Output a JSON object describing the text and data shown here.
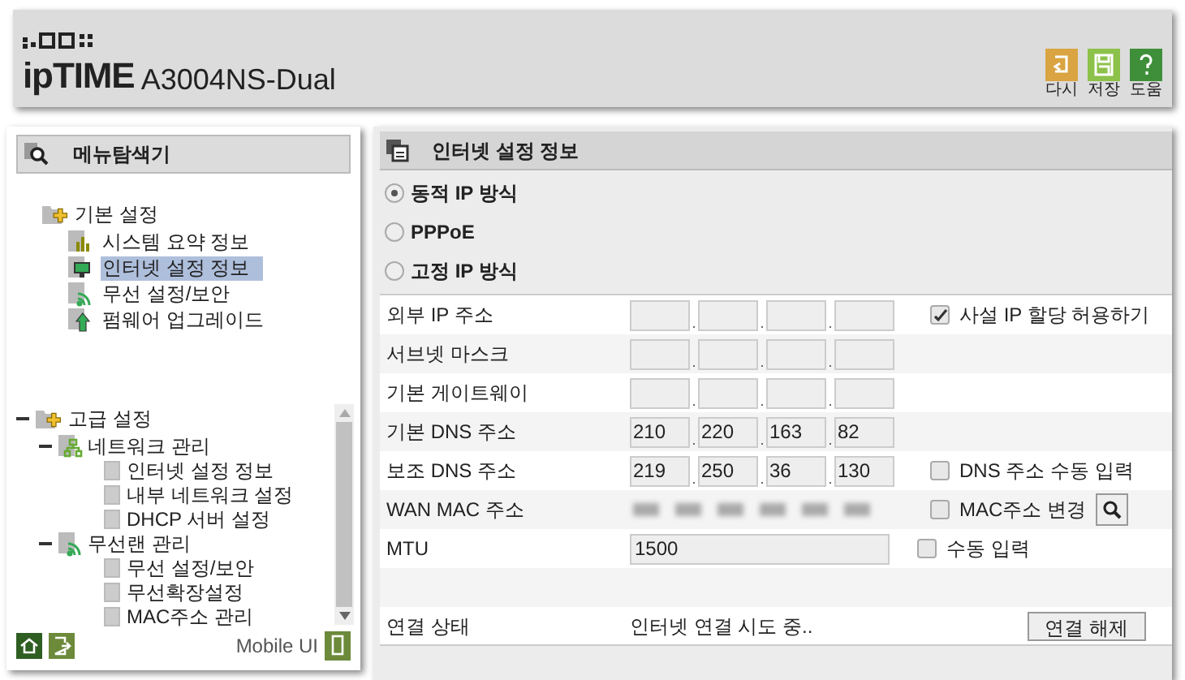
{
  "header": {
    "brand": "ipTIME",
    "model": "A3004NS-Dual",
    "actions": [
      {
        "label": "다시",
        "kind": "undo",
        "color": "#d9a441"
      },
      {
        "label": "저장",
        "kind": "save",
        "color": "#8cc14a"
      },
      {
        "label": "도움",
        "kind": "help",
        "color": "#3f8f3a"
      }
    ]
  },
  "sidebar": {
    "title": "메뉴탐색기",
    "basic": {
      "label": "기본 설정",
      "children": [
        {
          "label": "시스템 요약 정보",
          "kind": "chart",
          "selected": false
        },
        {
          "label": "인터넷 설정 정보",
          "kind": "monitor",
          "selected": true
        },
        {
          "label": "무선 설정/보안",
          "kind": "wifi",
          "selected": false
        },
        {
          "label": "펌웨어 업그레이드",
          "kind": "upgrade",
          "selected": false
        }
      ]
    },
    "advanced": {
      "label": "고급 설정",
      "expanded": true,
      "children": [
        {
          "label": "네트워크 관리",
          "kind": "network",
          "expanded": true,
          "children": [
            {
              "label": "인터넷 설정 정보"
            },
            {
              "label": "내부 네트워크 설정"
            },
            {
              "label": "DHCP 서버 설정"
            }
          ]
        },
        {
          "label": "무선랜 관리",
          "kind": "wifi",
          "expanded": true,
          "children": [
            {
              "label": "무선 설정/보안"
            },
            {
              "label": "무선확장설정"
            },
            {
              "label": "MAC주소 관리"
            }
          ]
        }
      ]
    },
    "footer": {
      "mobile_label": "Mobile UI"
    }
  },
  "panel": {
    "title": "인터넷 설정 정보",
    "modes": [
      {
        "label": "동적 IP 방식",
        "selected": true
      },
      {
        "label": "PPPoE",
        "selected": false
      },
      {
        "label": "고정 IP 방식",
        "selected": false
      }
    ],
    "rows": [
      {
        "kind": "ip",
        "label": "외부 IP 주소",
        "option": {
          "label": "사설 IP 할당 허용하기",
          "checked": true
        }
      },
      {
        "kind": "ip",
        "label": "서브넷 마스크"
      },
      {
        "kind": "ip",
        "label": "기본 게이트웨이"
      },
      {
        "kind": "ip",
        "label": "기본 DNS 주소",
        "octets": [
          "210",
          "220",
          "163",
          "82"
        ]
      },
      {
        "kind": "ip",
        "label": "보조 DNS 주소",
        "octets": [
          "219",
          "250",
          "36",
          "130"
        ],
        "option": {
          "label": "DNS 주소 수동 입력",
          "checked": false
        }
      },
      {
        "kind": "mac",
        "label": "WAN MAC 주소",
        "option": {
          "label": "MAC주소 변경",
          "checked": false
        },
        "search": true
      },
      {
        "kind": "text",
        "label": "MTU",
        "value": "1500",
        "option": {
          "label": "수동 입력",
          "checked": false
        }
      },
      {
        "kind": "empty"
      },
      {
        "kind": "status",
        "label": "연결 상태",
        "value": "인터넷 연결 시도 중..",
        "button": "연결 해제"
      }
    ]
  }
}
